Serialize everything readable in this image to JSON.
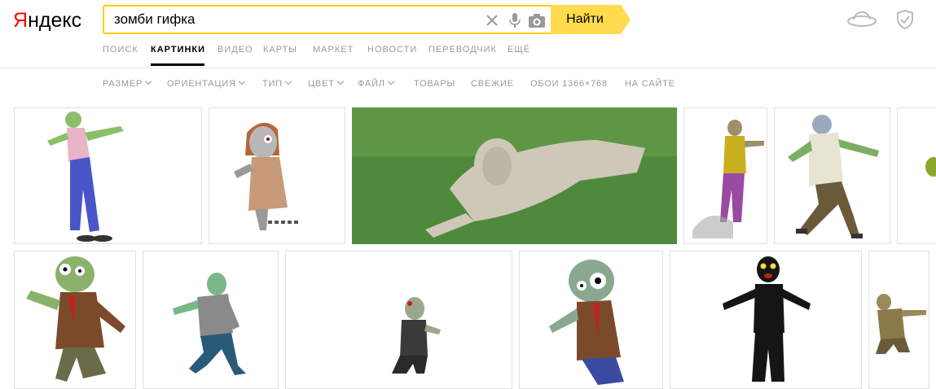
{
  "logo": {
    "text": "Яндекс"
  },
  "search": {
    "query": "зомби гифка",
    "button_label": "Найти",
    "clear_icon": "close-icon",
    "voice_icon": "microphone-icon",
    "camera_icon": "camera-icon"
  },
  "header_icons": [
    "weather-cloud-icon",
    "shield-icon"
  ],
  "services": [
    {
      "label": "ПОИСК",
      "active": false
    },
    {
      "label": "КАРТИНКИ",
      "active": true
    },
    {
      "label": "ВИДЕО",
      "active": false
    },
    {
      "label": "КАРТЫ",
      "active": false
    },
    {
      "label": "МАРКЕТ",
      "active": false
    },
    {
      "label": "НОВОСТИ",
      "active": false
    },
    {
      "label": "ПЕРЕВОДЧИК",
      "active": false
    },
    {
      "label": "ЕЩЁ",
      "active": false
    }
  ],
  "filters": [
    {
      "label": "РАЗМЕР",
      "dropdown": true
    },
    {
      "label": "ОРИЕНТАЦИЯ",
      "dropdown": true
    },
    {
      "label": "ТИП",
      "dropdown": true
    },
    {
      "label": "ЦВЕТ",
      "dropdown": true
    },
    {
      "label": "ФАЙЛ",
      "dropdown": true
    },
    {
      "label": "ТОВАРЫ",
      "dropdown": false
    },
    {
      "label": "СВЕЖИЕ",
      "dropdown": false
    },
    {
      "label": "ОБОИ 1366×768",
      "dropdown": false
    },
    {
      "label": "НА САЙТЕ",
      "dropdown": false
    }
  ],
  "colors": {
    "accent_yellow": "#ffdb4d",
    "search_border": "#ffcc00",
    "logo_red": "#ff0000",
    "muted_text": "#999999",
    "grass_green": "#4f8a3c",
    "zombie_green": "#7cae62"
  }
}
